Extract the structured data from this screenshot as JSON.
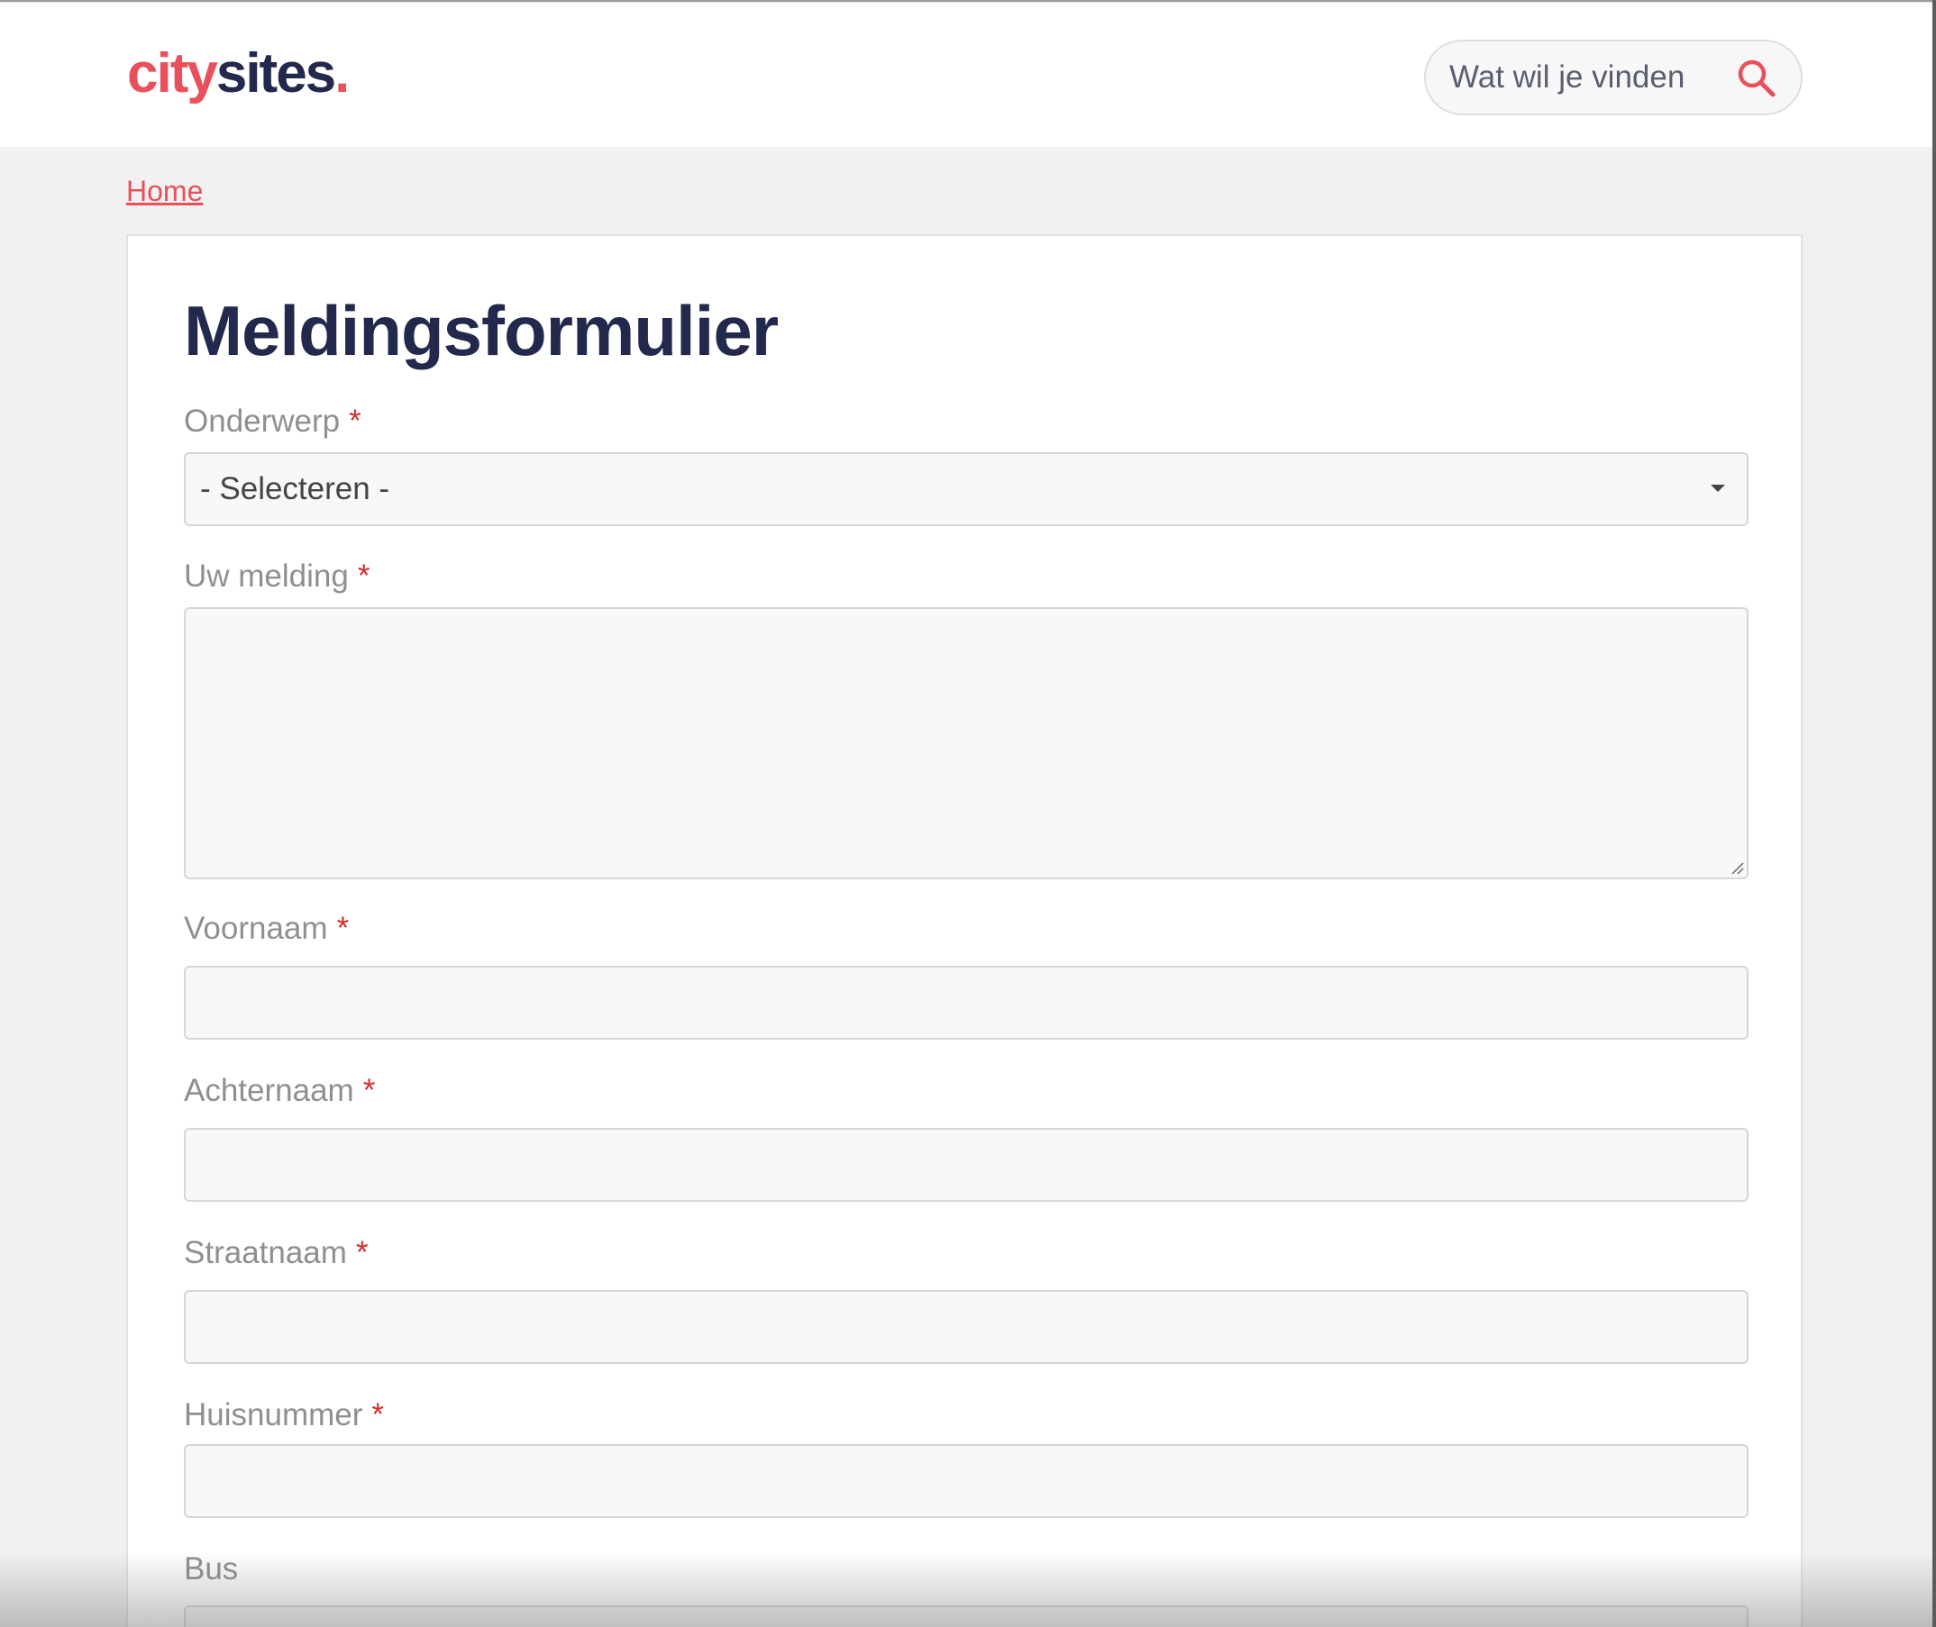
{
  "header": {
    "logo": {
      "part1": "city",
      "part2": "sites",
      "dot": "."
    },
    "search": {
      "placeholder": "Wat wil je vinden",
      "icon": "search-icon"
    }
  },
  "breadcrumb": {
    "home": "Home"
  },
  "form": {
    "title": "Meldingsformulier",
    "required_marker": "*",
    "fields": {
      "onderwerp": {
        "label": "Onderwerp",
        "value": "- Selecteren -"
      },
      "melding": {
        "label": "Uw melding"
      },
      "voornaam": {
        "label": "Voornaam"
      },
      "achternaam": {
        "label": "Achternaam"
      },
      "straatnaam": {
        "label": "Straatnaam"
      },
      "huisnummer": {
        "label": "Huisnummer"
      },
      "bus": {
        "label": "Bus"
      }
    }
  },
  "colors": {
    "brand_accent": "#e8505b",
    "brand_dark": "#23294d",
    "required": "#d32f2f"
  }
}
